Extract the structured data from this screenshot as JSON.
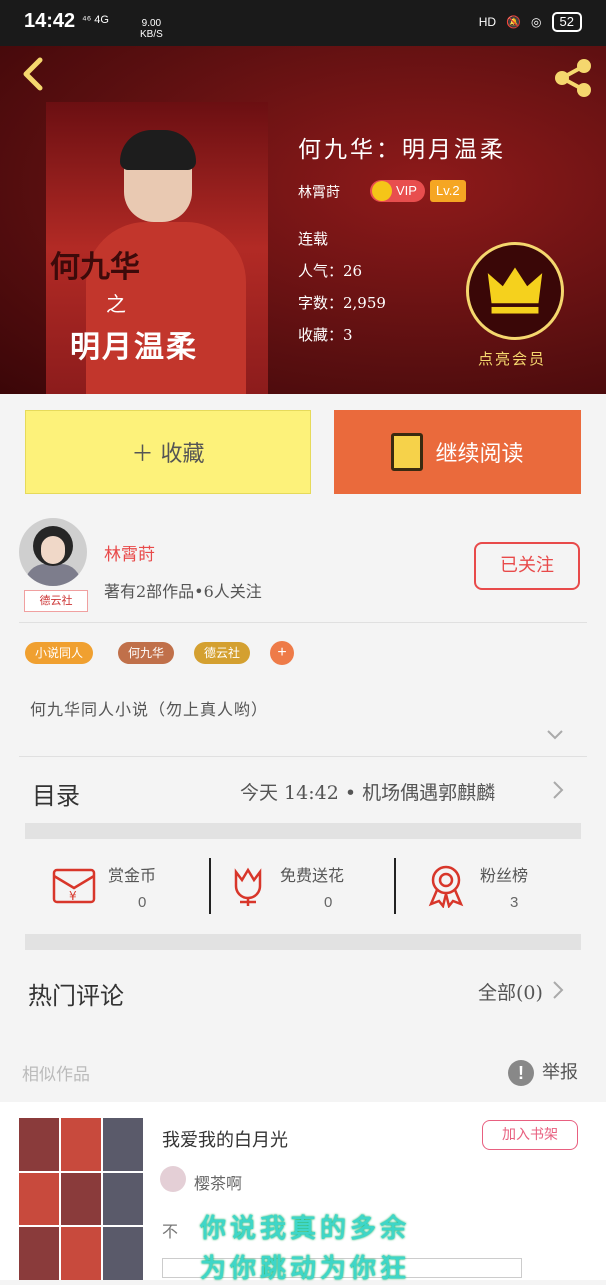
{
  "status_bar": {
    "time": "14:42",
    "network": "⁴⁶ 4G",
    "speed_value": "9.00",
    "speed_unit": "KB/S",
    "hd": "HD",
    "battery": "52"
  },
  "book": {
    "title": "何九华：明月温柔",
    "author": "林霄莳",
    "vip_label": "VIP",
    "level": "Lv.2",
    "status": "连载",
    "popularity": "人气：26",
    "word_count": "字数：2,959",
    "favorites": "收藏：3",
    "cover_text_1": "何九华",
    "cover_text_2": "之",
    "cover_text_3": "明月温柔",
    "vip_action": "点亮会员"
  },
  "actions": {
    "collect_label": "＋ 收藏",
    "read_label": "继续阅读"
  },
  "author_card": {
    "name": "林霄莳",
    "stats": "著有2部作品•6人关注",
    "badge": "德云社",
    "follow_label": "已关注"
  },
  "tags": [
    "小说同人",
    "何九华",
    "德云社"
  ],
  "tag_add": "+",
  "description": "何九华同人小说（勿上真人哟）",
  "toc": {
    "label": "目录",
    "latest": "今天 14:42 • 机场偶遇郭麒麟"
  },
  "stats": [
    {
      "label": "赏金币",
      "value": "0"
    },
    {
      "label": "免费送花",
      "value": "0"
    },
    {
      "label": "粉丝榜",
      "value": "3"
    }
  ],
  "comments": {
    "label": "热门评论",
    "all_label": "全部(0)"
  },
  "similar": {
    "label": "相似作品",
    "report_label": "举报",
    "report_icon": "!"
  },
  "similar_book": {
    "title": "我爱我的白月光",
    "add_shelf_label": "加入书架",
    "author": "樱茶啊",
    "snippet_start": "不",
    "overlay_line_1": "你说我真的多余",
    "overlay_line_2": "为你跳动为你狂"
  },
  "colors": {
    "accent_red": "#e84a4a",
    "collect_yellow": "#fdf27a",
    "read_orange": "#ea6a3c",
    "gold": "#f5d76e"
  }
}
